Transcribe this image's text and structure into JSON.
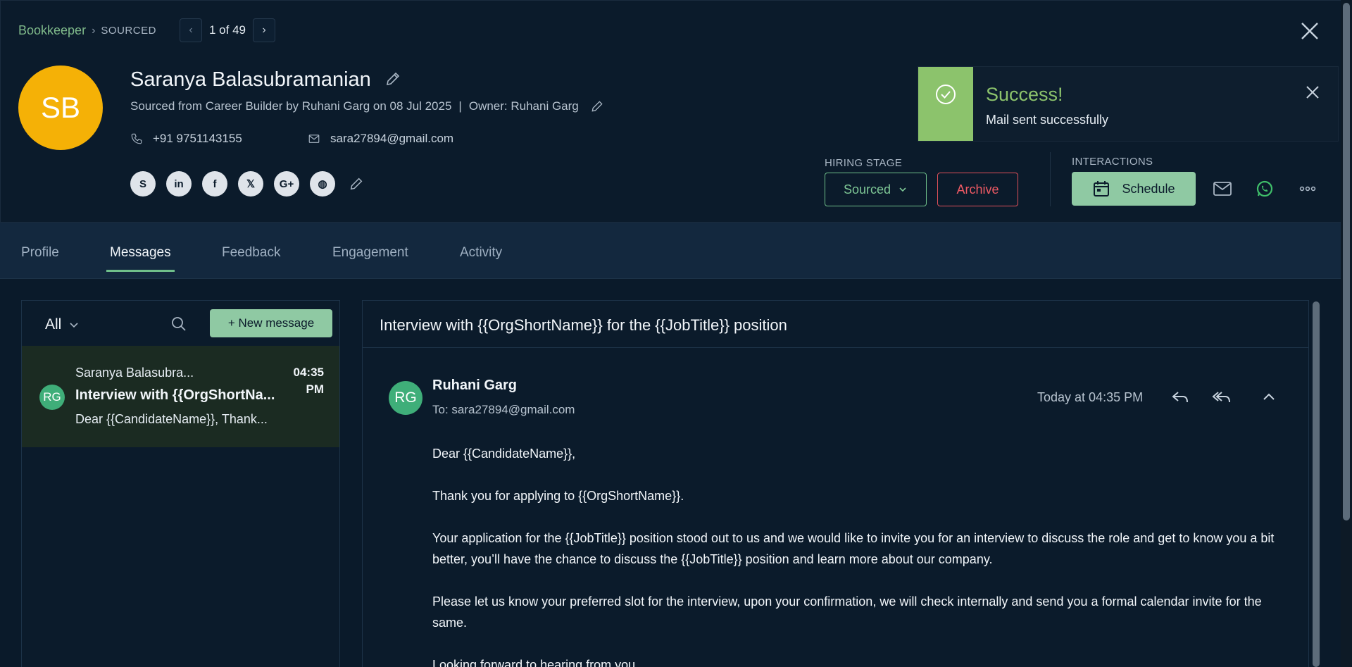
{
  "header": {
    "breadcrumb_job": "Bookkeeper",
    "breadcrumb_stage": "SOURCED",
    "pager_text": "1 of 49"
  },
  "candidate": {
    "initials": "SB",
    "name": "Saranya Balasubramanian",
    "sourced_line": "Sourced from Career Builder by Ruhani Garg on 08 Jul 2025",
    "owner_line": "Owner: Ruhani Garg",
    "phone": "+91 9751143155",
    "email": "sara27894@gmail.com",
    "socials": [
      "skype-icon",
      "linkedin-icon",
      "facebook-icon",
      "x-icon",
      "google-plus-icon",
      "website-icon"
    ]
  },
  "toast": {
    "title": "Success!",
    "message": "Mail sent successfully",
    "color": "#8cc36c"
  },
  "hiring_stage": {
    "label": "HIRING STAGE",
    "value": "Sourced",
    "archive_label": "Archive"
  },
  "interactions": {
    "label": "INTERACTIONS",
    "schedule_label": "Schedule"
  },
  "tabs": [
    {
      "label": "Profile"
    },
    {
      "label": "Messages",
      "active": true
    },
    {
      "label": "Feedback"
    },
    {
      "label": "Engagement"
    },
    {
      "label": "Activity"
    }
  ],
  "messages_list": {
    "filter": "All",
    "new_message_label": "+ New message",
    "items": [
      {
        "initials": "RG",
        "from": "Saranya Balasubra...",
        "subject": "Interview with {{OrgShortNa...",
        "preview": "Dear {{CandidateName}}, Thank...",
        "time_line1": "04:35",
        "time_line2": "PM"
      }
    ]
  },
  "message_view": {
    "subject": "Interview with {{OrgShortName}} for the {{JobTitle}} position",
    "sender_initials": "RG",
    "sender": "Ruhani Garg",
    "to": "To: sara27894@gmail.com",
    "time": "Today at 04:35 PM",
    "body": [
      "Dear {{CandidateName}},",
      "Thank you for applying to {{OrgShortName}}.",
      "Your application for the {{JobTitle}} position stood out to us and we would like to invite you for an interview to discuss the role and get to know you a bit better, you’ll have the chance to discuss the {{JobTitle}} position and learn more about our company.",
      "Please let us know your preferred slot for the interview, upon your confirmation, we will check internally and send you a formal calendar invite for the same.",
      "Looking forward to hearing from you."
    ]
  },
  "colors": {
    "accent_green": "#8fc9a3",
    "avatar_yellow": "#f5b106",
    "archive_red": "#ef5a64",
    "background": "#0a1a2a"
  }
}
